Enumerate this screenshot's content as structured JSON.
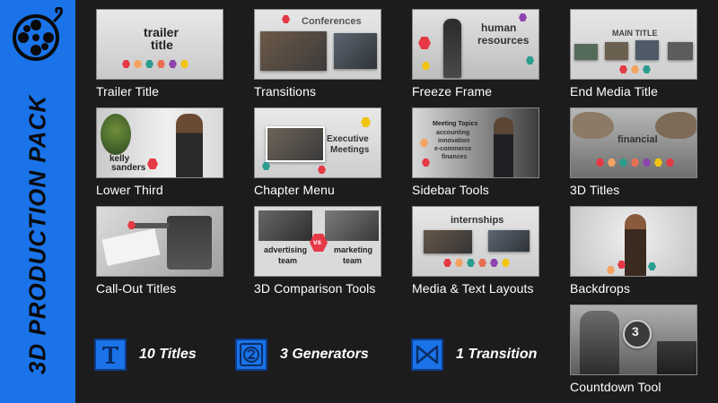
{
  "sidebar": {
    "title": "3D PRODUCTION PACK",
    "icon": "film-reel-icon",
    "background": "#1a73e8"
  },
  "tiles": [
    {
      "label": "Trailer Title",
      "overlay": [
        "trailer",
        "title"
      ]
    },
    {
      "label": "Transitions",
      "overlay": [
        "Conferences"
      ]
    },
    {
      "label": "Freeze Frame",
      "overlay": [
        "human",
        "resources"
      ]
    },
    {
      "label": "End Media Title",
      "overlay": [
        "MAIN TITLE"
      ]
    },
    {
      "label": "Lower Third",
      "overlay": [
        "kelly",
        "sanders"
      ]
    },
    {
      "label": "Chapter Menu",
      "overlay": [
        "Executive",
        "Meetings"
      ]
    },
    {
      "label": "Sidebar Tools",
      "overlay": [
        "Meeting Topics",
        "accounting",
        "innovation",
        "e-commerce",
        "finances"
      ]
    },
    {
      "label": "3D Titles",
      "overlay": [
        "financial"
      ]
    },
    {
      "label": "Call-Out Titles",
      "overlay": []
    },
    {
      "label": "3D Comparison Tools",
      "overlay": [
        "advertising",
        "team",
        "vs",
        "marketing",
        "team"
      ]
    },
    {
      "label": "Media & Text Layouts",
      "overlay": [
        "internships"
      ]
    },
    {
      "label": "Backdrops",
      "overlay": []
    },
    {
      "label": "Countdown Tool",
      "overlay": [
        "3"
      ]
    }
  ],
  "features": [
    {
      "icon": "title-t-icon",
      "label": "10 Titles"
    },
    {
      "icon": "generator-circle-icon",
      "label": "3 Generators"
    },
    {
      "icon": "transition-bowtie-icon",
      "label": "1 Transition"
    }
  ],
  "colors": {
    "background": "#1c1c1d",
    "accent": "#1a73e8",
    "hex_palette": [
      "#e63946",
      "#f4a261",
      "#2a9d8f",
      "#e76f51",
      "#8e44ad",
      "#f1c40f"
    ]
  }
}
